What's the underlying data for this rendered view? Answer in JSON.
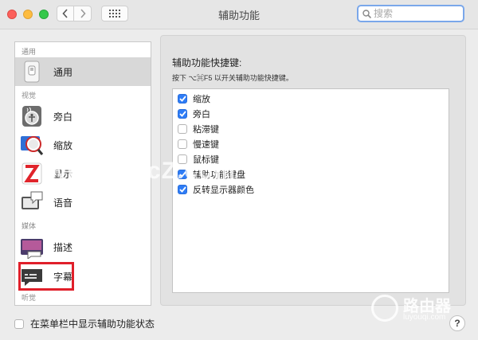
{
  "window": {
    "title": "辅助功能"
  },
  "search": {
    "placeholder": "搜索"
  },
  "sidebar": {
    "sections": [
      "通用",
      "视觉",
      "媒体",
      "听觉"
    ],
    "items": [
      {
        "label": "通用",
        "icon": "general-icon",
        "selected": true
      },
      {
        "label": "旁白",
        "icon": "voiceover-icon"
      },
      {
        "label": "缩放",
        "icon": "zoom-icon"
      },
      {
        "label": "显示",
        "icon": "display-icon"
      },
      {
        "label": "语音",
        "icon": "speech-icon"
      },
      {
        "label": "描述",
        "icon": "descriptions-icon"
      },
      {
        "label": "字幕",
        "icon": "captions-icon"
      }
    ]
  },
  "main": {
    "shortcut_title": "辅助功能快捷键:",
    "shortcut_hint": "按下 ⌥⌘F5 以开关辅助功能快捷键。",
    "options": [
      {
        "label": "缩放",
        "checked": true
      },
      {
        "label": "旁白",
        "checked": true
      },
      {
        "label": "粘滞键",
        "checked": false
      },
      {
        "label": "慢速键",
        "checked": false
      },
      {
        "label": "鼠标键",
        "checked": false
      },
      {
        "label": "辅助功能键盘",
        "checked": true
      },
      {
        "label": "反转显示器颜色",
        "checked": true
      }
    ]
  },
  "footer": {
    "menubar_status_label": "在菜单栏中显示辅助功能状态",
    "menubar_status_checked": false,
    "help_label": "?"
  },
  "watermarks": {
    "site": "www.MacZ.com",
    "brand_cn": "路由器",
    "brand_en": "luyouqi.com"
  },
  "colors": {
    "accent": "#2e7cf6",
    "selection": "#d8d8d8",
    "highlight_box": "#e01f2a"
  }
}
